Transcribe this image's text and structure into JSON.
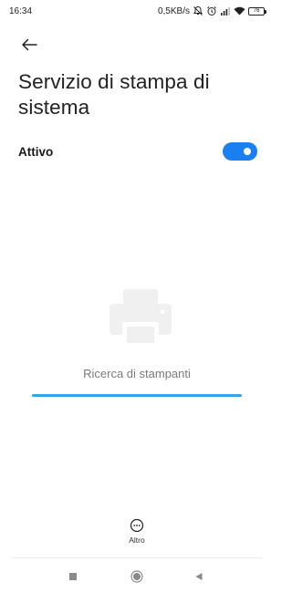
{
  "status_bar": {
    "time": "16:34",
    "network_speed": "0,5KB/s",
    "battery_level": "76",
    "icons": [
      "mute-icon",
      "alarm-icon",
      "signal-icon",
      "wifi-icon",
      "battery-icon"
    ]
  },
  "header": {
    "back_icon": "arrow-left-icon",
    "title": "Servizio di stampa di sistema"
  },
  "toggle": {
    "label": "Attivo",
    "state": "on",
    "accent_color": "#1a7ff0"
  },
  "empty_state": {
    "icon": "printer-icon",
    "message": "Ricerca di stampanti",
    "progress_color": "#35a4e6"
  },
  "bottom_action": {
    "icon": "more-icon",
    "label": "Altro"
  },
  "navigation": {
    "recents_icon": "square-icon",
    "home_icon": "circle-icon",
    "back_icon": "triangle-back-icon"
  }
}
